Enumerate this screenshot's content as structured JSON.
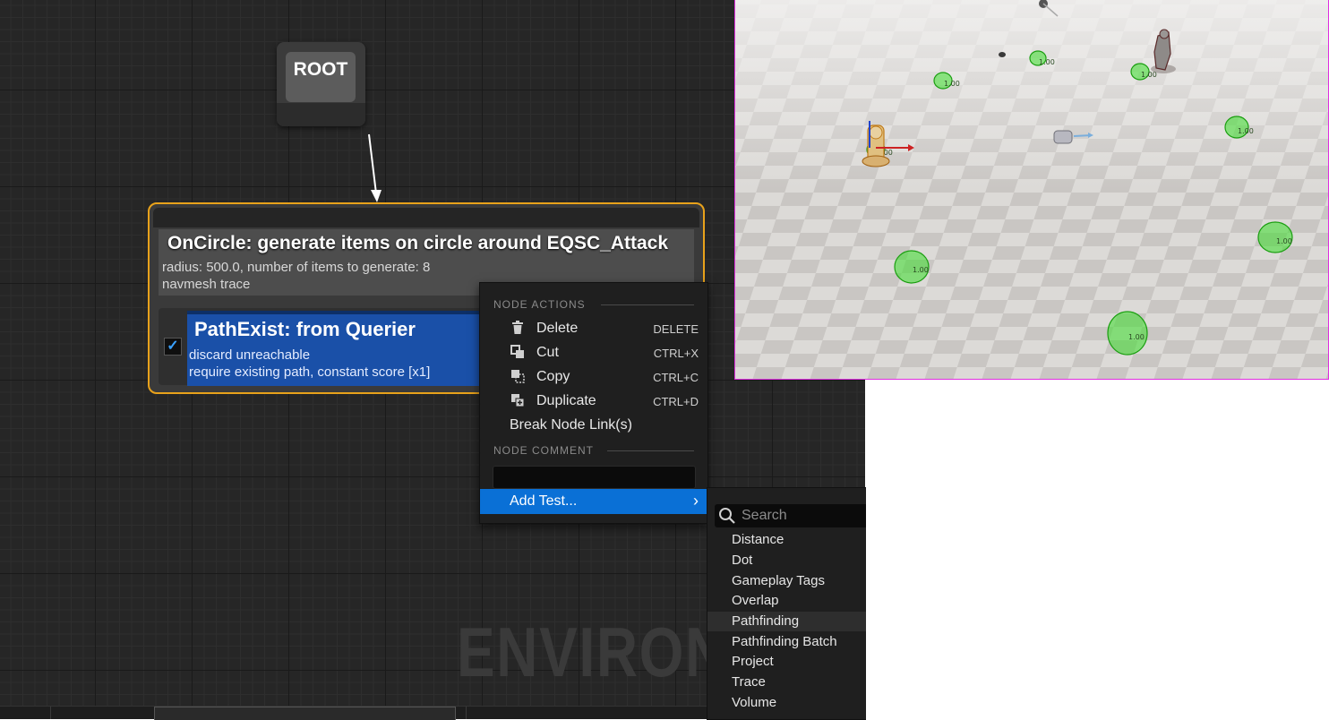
{
  "root_node": {
    "label": "ROOT"
  },
  "generator_node": {
    "title": "OnCircle: generate items on circle around EQSC_Attack",
    "line1": "radius: 500.0, number of items to generate: 8",
    "line2": "navmesh trace"
  },
  "test_node": {
    "checked": true,
    "title": "PathExist: from Querier",
    "line1": "discard unreachable",
    "line2": "require existing path, constant score [x1]"
  },
  "watermark": "ENVIRON",
  "context_menu": {
    "section_actions": "NODE ACTIONS",
    "items": [
      {
        "icon": "trash-icon",
        "label": "Delete",
        "shortcut": "DELETE"
      },
      {
        "icon": "cut-icon",
        "label": "Cut",
        "shortcut": "CTRL+X"
      },
      {
        "icon": "copy-icon",
        "label": "Copy",
        "shortcut": "CTRL+C"
      },
      {
        "icon": "duplicate-icon",
        "label": "Duplicate",
        "shortcut": "CTRL+D"
      },
      {
        "icon": "",
        "label": "Break Node Link(s)",
        "shortcut": ""
      }
    ],
    "section_comment": "NODE COMMENT",
    "comment_value": "",
    "add_test_label": "Add Test..."
  },
  "submenu": {
    "search_placeholder": "Search",
    "items": [
      "Distance",
      "Dot",
      "Gameplay Tags",
      "Overlap",
      "Pathfinding",
      "Pathfinding Batch",
      "Project",
      "Trace",
      "Volume"
    ],
    "highlighted": "Pathfinding"
  },
  "viewport": {
    "item_score_label": "1.00",
    "border_color": "#e02ee0",
    "item_color": "#3adf2a"
  },
  "colors": {
    "node_outline": "#e8a21b",
    "test_card": "#1a50a8",
    "menu_highlight": "#0a70d6"
  }
}
